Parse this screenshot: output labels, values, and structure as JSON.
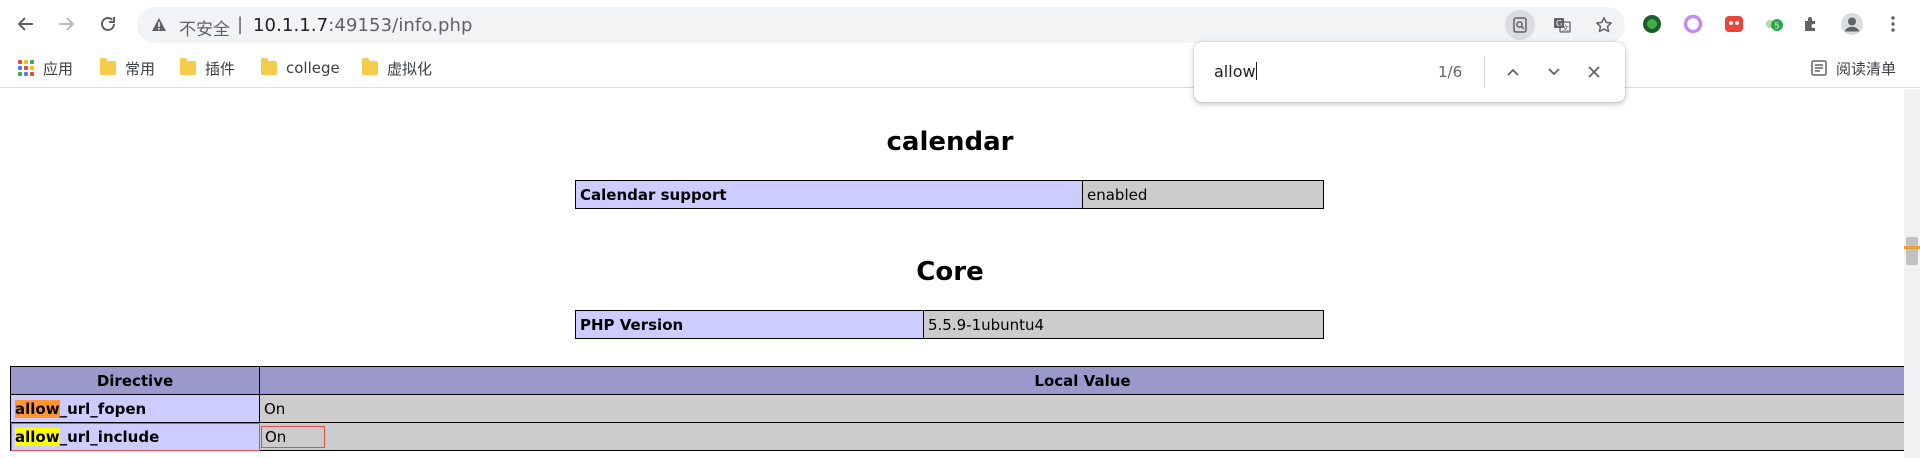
{
  "browser": {
    "url_warning": "不安全",
    "url_separator": "|",
    "url_host": "10.1.1.7",
    "url_path": ":49153/info.php"
  },
  "bookmarks": {
    "items": [
      {
        "label": "应用"
      },
      {
        "label": "常用"
      },
      {
        "label": "插件"
      },
      {
        "label": "college"
      },
      {
        "label": "虚拟化"
      }
    ],
    "reading_list": "阅读清单"
  },
  "find": {
    "query": "allow",
    "count": "1/6"
  },
  "page": {
    "sections": [
      {
        "title": "calendar",
        "rows": [
          {
            "key": "Calendar support",
            "value": "enabled"
          }
        ]
      },
      {
        "title": "Core",
        "rows": [
          {
            "key": "PHP Version",
            "value": "5.5.9-1ubuntu4"
          }
        ]
      }
    ],
    "directives": {
      "headers": [
        "Directive",
        "Local Value"
      ],
      "match": "allow",
      "rows": [
        {
          "name_rest": "_url_fopen",
          "value": "On"
        },
        {
          "name_rest": "_url_include",
          "value": "On"
        }
      ]
    }
  },
  "colors": {
    "key_cell": "#ccccff",
    "value_cell": "#cccccc",
    "header_cell": "#9999cc",
    "active_match": "#ff9632",
    "other_match": "#ffff00"
  }
}
